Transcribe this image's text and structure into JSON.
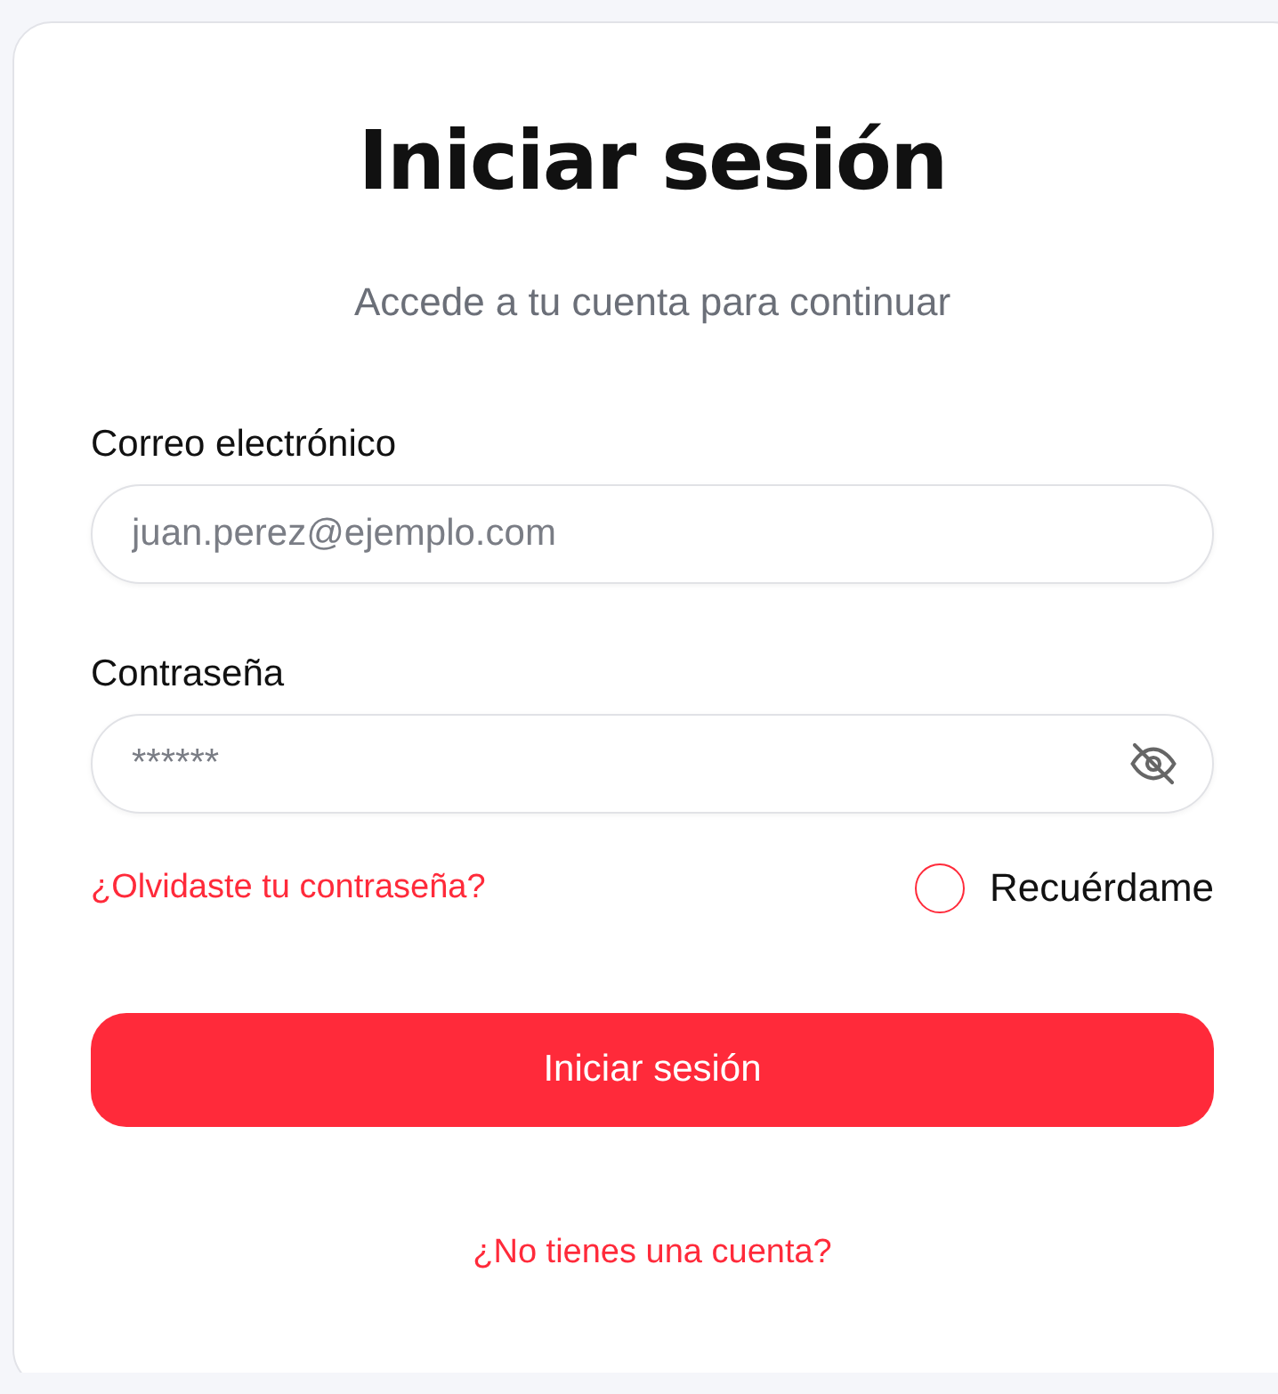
{
  "title": "Iniciar sesión",
  "subtitle": "Accede a tu cuenta para continuar",
  "fields": [
    {
      "label": "Correo electrónico",
      "placeholder": "juan.perez@ejemplo.com",
      "kind": "email"
    },
    {
      "label": "Contraseña",
      "placeholder": "******",
      "kind": "password",
      "visible": false
    }
  ],
  "forgot_link": "¿Olvidaste tu contraseña?",
  "remember": {
    "label": "Recuérdame",
    "checked": false
  },
  "submit_button": "Iniciar sesión",
  "signup_link": "¿No tienes una cuenta?"
}
